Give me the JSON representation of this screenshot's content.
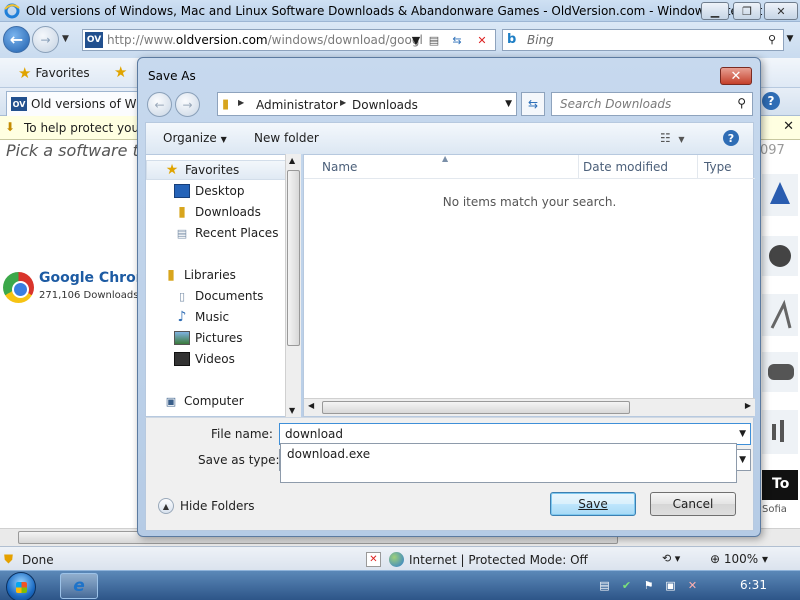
{
  "ie": {
    "title": "Old versions of Windows, Mac and Linux Software Downloads & Abandonware Games - OldVersion.com - Windows Internet ...",
    "favicon_label": "OV",
    "address_dim": "http://www.",
    "address_host": "oldversion.com",
    "address_rest": "/windows/download/googl",
    "search_placeholder": "Bing",
    "favorites_label": "Favorites",
    "tab_label": "Old versions of Wind",
    "infobar_text": "To help protect your",
    "page_heading": "Pick a software title",
    "page_date_fragment": "097",
    "listing": {
      "name": "Google Chrom",
      "downloads": "271,106 Downloads"
    },
    "status_text": "Done",
    "zone_text": "Internet | Protected Mode: Off",
    "zoom": "100%"
  },
  "dialog": {
    "title": "Save As",
    "breadcrumb": [
      "Administrator",
      "Downloads"
    ],
    "search_placeholder": "Search Downloads",
    "toolbar": {
      "organize": "Organize",
      "new_folder": "New folder"
    },
    "nav": {
      "favorites": "Favorites",
      "desktop": "Desktop",
      "downloads": "Downloads",
      "recent": "Recent Places",
      "libraries": "Libraries",
      "documents": "Documents",
      "music": "Music",
      "pictures": "Pictures",
      "videos": "Videos",
      "computer": "Computer"
    },
    "columns": [
      "Name",
      "Date modified",
      "Type"
    ],
    "empty_message": "No items match your search.",
    "file_name_label": "File name:",
    "file_name_value": "download",
    "save_type_label": "Save as type:",
    "save_type_option": "download.exe",
    "hide_folders": "Hide Folders",
    "save_label": "Save",
    "cancel_label": "Cancel"
  },
  "taskbar": {
    "clock": "6:31"
  }
}
